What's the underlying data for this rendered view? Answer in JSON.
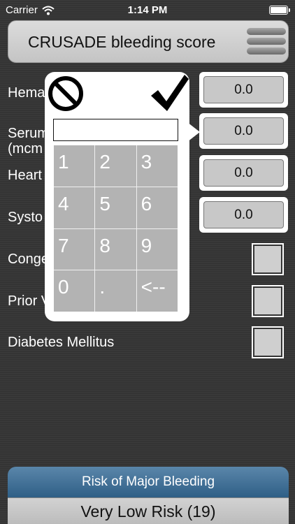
{
  "status_bar": {
    "carrier": "Carrier",
    "time": "1:14 PM"
  },
  "header": {
    "title": "CRUSADE bleeding score"
  },
  "inputs": [
    {
      "label": "Hema",
      "value": "0.0"
    },
    {
      "label": "Serum",
      "label2": "(mcm",
      "value": "0.0"
    },
    {
      "label": "Heart",
      "value": "0.0"
    },
    {
      "label": "Systo",
      "value": "0.0"
    }
  ],
  "checkboxes": [
    {
      "label": "Conge"
    },
    {
      "label": "Prior V"
    },
    {
      "label": "Diabetes Mellitus"
    }
  ],
  "keypad": {
    "input_value": "",
    "keys": [
      "1",
      "2",
      "3",
      "4",
      "5",
      "6",
      "7",
      "8",
      "9",
      "0",
      ".",
      "<--"
    ]
  },
  "result": {
    "heading": "Risk of Major Bleeding",
    "value": "Very Low Risk (19)"
  }
}
